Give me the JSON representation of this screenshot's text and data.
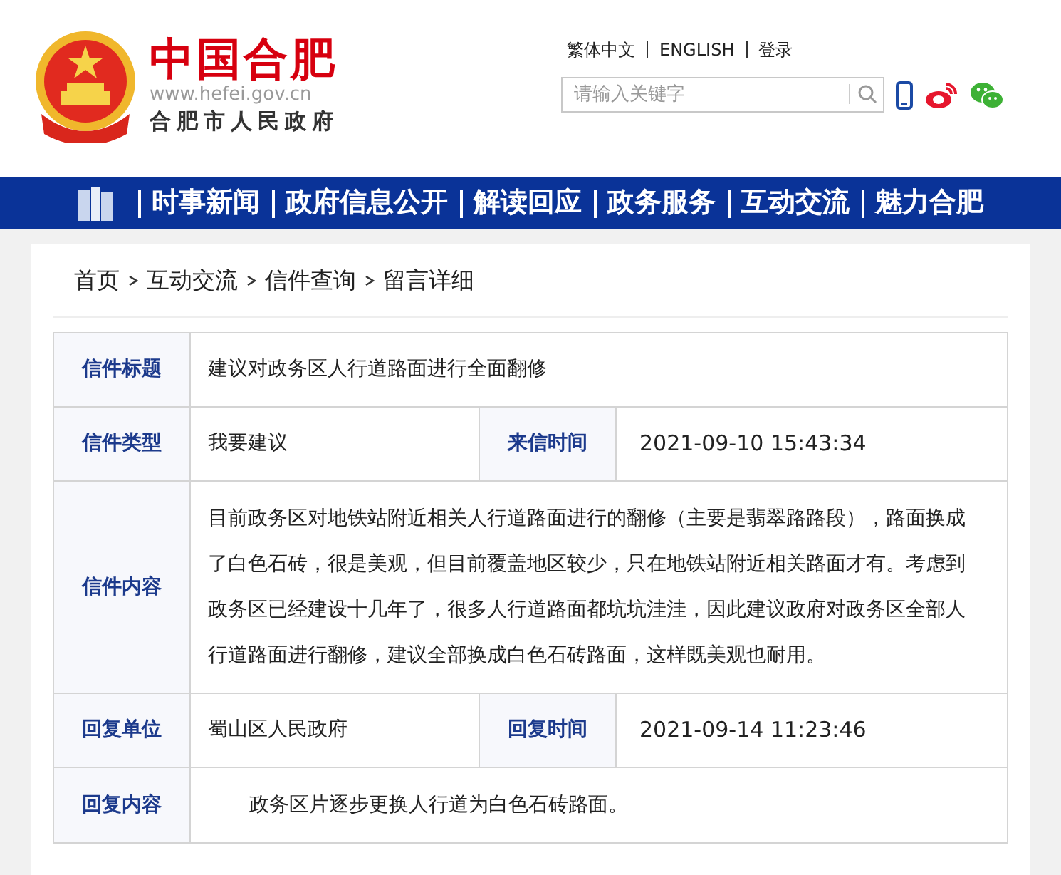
{
  "header": {
    "logo_title": "中国合肥",
    "logo_url": "www.hefei.gov.cn",
    "logo_subtitle": "合肥市人民政府",
    "top_links": [
      "繁体中文",
      "ENGLISH",
      "登录"
    ],
    "search": {
      "placeholder": "请输入关键字"
    }
  },
  "nav": {
    "items": [
      "时事新闻",
      "政府信息公开",
      "解读回应",
      "政务服务",
      "互动交流",
      "魅力合肥"
    ]
  },
  "breadcrumb": [
    "首页",
    "互动交流",
    "信件查询",
    "留言详细"
  ],
  "letter": {
    "rows": [
      {
        "kind": "single",
        "label": "信件标题",
        "value": "建议对政务区人行道路面进行全面翻修"
      },
      {
        "kind": "pair",
        "label": "信件类型",
        "value": "我要建议",
        "label2": "来信时间",
        "value2": "2021-09-10 15:43:34"
      },
      {
        "kind": "paragraph",
        "label": "信件内容",
        "value": "目前政务区对地铁站附近相关人行道路面进行的翻修（主要是翡翠路路段），路面换成了白色石砖，很是美观，但目前覆盖地区较少，只在地铁站附近相关路面才有。考虑到政务区已经建设十几年了，很多人行道路面都坑坑洼洼，因此建议政府对政务区全部人行道路面进行翻修，建议全部换成白色石砖路面，这样既美观也耐用。"
      },
      {
        "kind": "pair",
        "label": "回复单位",
        "value": "蜀山区人民政府",
        "label2": "回复时间",
        "value2": "2021-09-14 11:23:46"
      },
      {
        "kind": "indented",
        "label": "回复内容",
        "value": "政务区片逐步更换人行道为白色石砖路面。"
      }
    ]
  }
}
